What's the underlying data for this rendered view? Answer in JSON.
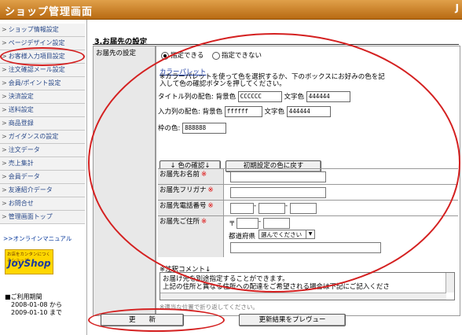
{
  "header": {
    "title": "ショップ管理画面",
    "logo": "J"
  },
  "sidebar": {
    "items": [
      {
        "label": "ショップ情報設定"
      },
      {
        "label": "ページデザイン設定"
      },
      {
        "label": "お客様入力項目設定"
      },
      {
        "label": "注文確認メール設定"
      },
      {
        "label": "会員/ポイント設定"
      },
      {
        "label": "決済設定"
      },
      {
        "label": "送料設定"
      },
      {
        "label": "商品登録"
      },
      {
        "label": "ガイダンスの設定"
      },
      {
        "label": "注文データ"
      },
      {
        "label": "売上集計"
      },
      {
        "label": "会員データ"
      },
      {
        "label": "友達紹介データ"
      },
      {
        "label": "お問合せ"
      },
      {
        "label": "管理画面トップ"
      }
    ],
    "arrow": ">",
    "manual_link": ">>オンラインマニュアル",
    "banner": {
      "small": "お店をカンタンにつくるショップ",
      "big": "JoyShop"
    },
    "usage": {
      "title": "■ご利用期間",
      "from": "2008-01-08  から",
      "to": "2009-01-10  まで"
    }
  },
  "main": {
    "section_title": "3.お届先の設定",
    "row_label": "お届先の設定",
    "radio": {
      "on": "指定できる",
      "off": "指定できない"
    },
    "color_palette": {
      "link": "カラーパレット",
      "note": "※カラーパレットを使って色を選択するか、下のボックスにお好みの色を記入して色の確認ボタンを押してください。",
      "title_row": {
        "label": "タイトル列の配色:",
        "bg_label": "背景色",
        "bg": "CCCCCC",
        "fg_label": "文字色",
        "fg": "444444"
      },
      "input_row": {
        "label": "入力列の配色:",
        "bg_label": "背景色",
        "bg": "ffffff",
        "fg_label": "文字色",
        "fg": "444444"
      },
      "frame_row": {
        "label": "枠の色:",
        "value": "888888"
      },
      "confirm_button": "↓ 色の確認↓",
      "reset_button": "初期設定の色に戻す"
    },
    "form": {
      "name": "お届先お名前",
      "furigana": "お届先フリガナ",
      "phone": "お届先電話番号",
      "address": "お届先ご住所",
      "required_mark": "※",
      "postal_mark": "〒",
      "dash": "-",
      "pref_label": "都道府県",
      "pref_select": "選んでください"
    },
    "note": {
      "title": "※注釈コメント↓",
      "line1": "お届け先を別途指定することができます。",
      "line2": "上記の住所と異なる住所への配達をご希望される場合は下記にご記入くださ",
      "hint": "※適当な位置で折り返してください。"
    },
    "buttons": {
      "update": "更　　新",
      "preview": "更新結果をプレヴュー"
    }
  },
  "annotation_color": "#d42020"
}
